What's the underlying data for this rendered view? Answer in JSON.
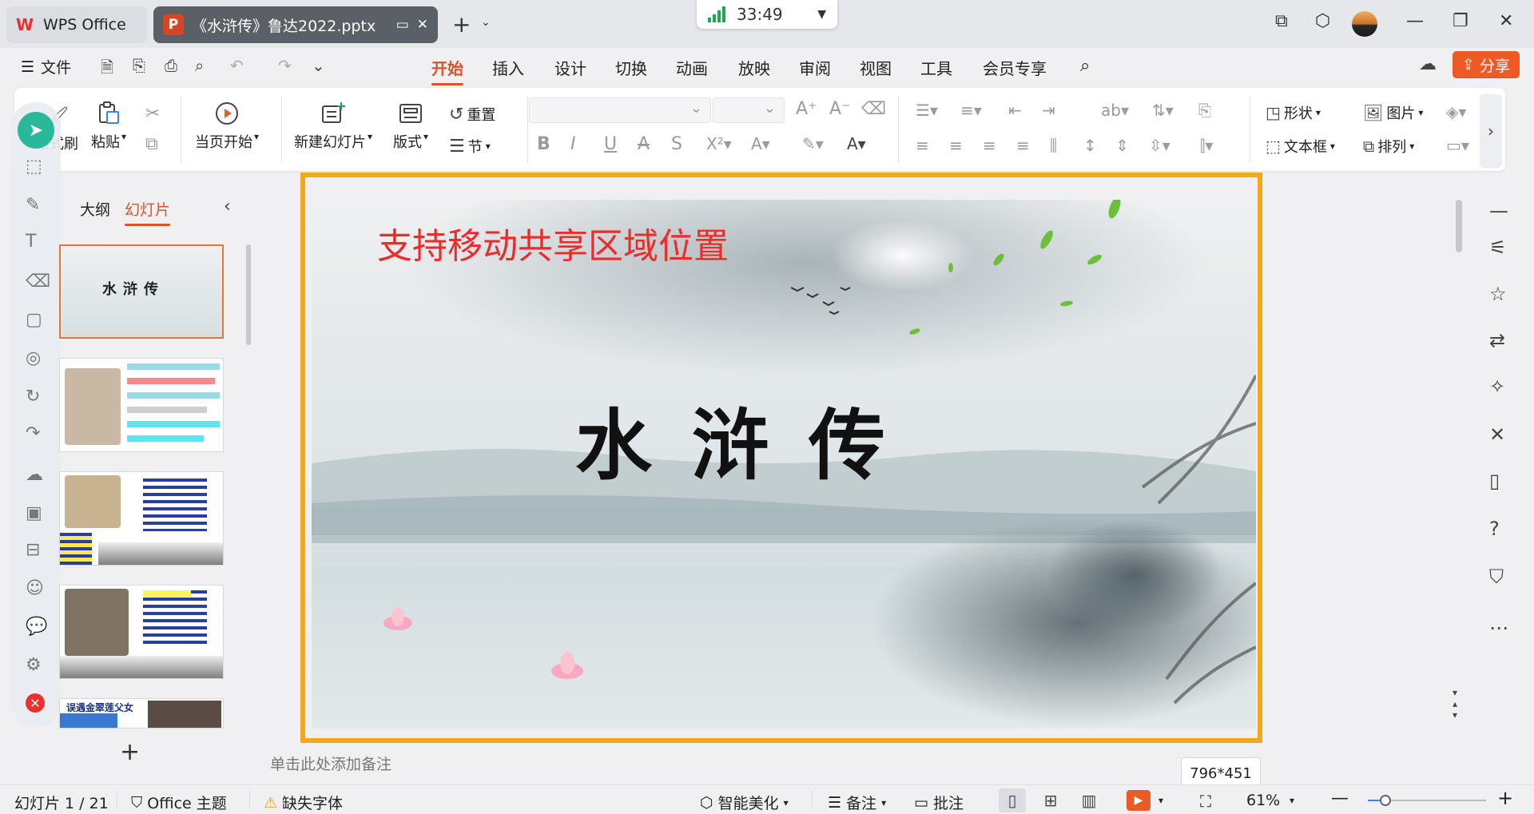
{
  "titlebar": {
    "home_tab": "WPS Office",
    "doc_tab": "《水浒传》鲁达2022.pptx",
    "timer": "33:49"
  },
  "menubar": {
    "file": "文件",
    "tabs": [
      "开始",
      "插入",
      "设计",
      "切换",
      "动画",
      "放映",
      "审阅",
      "视图",
      "工具",
      "会员专享"
    ],
    "active_tab": "开始",
    "share": "分享"
  },
  "ribbon": {
    "format_brush": "格式刷",
    "paste": "粘贴",
    "from_start": "当页开始",
    "new_slide": "新建幻灯片",
    "layout": "版式",
    "reset": "重置",
    "section": "节",
    "shape": "形状",
    "picture": "图片",
    "textbox": "文本框",
    "arrange": "排列"
  },
  "panel": {
    "tab_outline": "大纲",
    "tab_slides": "幻灯片",
    "active": "幻灯片"
  },
  "slide": {
    "caption": "支持移动共享区域位置",
    "title": "水浒传"
  },
  "thumbs": [
    {
      "title": "水浒传"
    },
    {
      "title": ""
    },
    {
      "title": ""
    },
    {
      "title": ""
    },
    {
      "title": "误遇金翠莲父女"
    }
  ],
  "notes_placeholder": "单击此处添加备注",
  "dimension_tip": "796*451",
  "statusbar": {
    "slide_counter": "幻灯片 1 / 21",
    "theme": "Office 主题",
    "missing_font": "缺失字体",
    "smart_beautify": "智能美化",
    "notes": "备注",
    "comment": "批注",
    "zoom": "61%",
    "zoom_fraction": 0.15
  },
  "colors": {
    "accent": "#d9532b",
    "selection_border": "#f4a818",
    "share": "#ee5a24",
    "caption": "#ee2a2a",
    "cursor_tool": "#2ab89a"
  }
}
